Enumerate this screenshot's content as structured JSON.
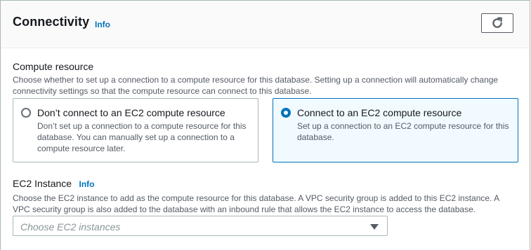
{
  "header": {
    "title": "Connectivity",
    "info_label": "Info"
  },
  "compute": {
    "label": "Compute resource",
    "description": "Choose whether to set up a connection to a compute resource for this database. Setting up a connection will automatically change connectivity settings so that the compute resource can connect to this database.",
    "options": [
      {
        "title": "Don’t connect to an EC2 compute resource",
        "description": "Don’t set up a connection to a compute resource for this database. You can manually set up a connection to a compute resource later.",
        "selected": false
      },
      {
        "title": "Connect to an EC2 compute resource",
        "description": "Set up a connection to an EC2 compute resource for this database.",
        "selected": true
      }
    ]
  },
  "ec2": {
    "label": "EC2 Instance",
    "info_label": "Info",
    "description": "Choose the EC2 instance to add as the compute resource for this database. A VPC security group is added to this EC2 instance. A VPC security group is also added to the database with an inbound rule that allows the EC2 instance to access the database.",
    "select_placeholder": "Choose EC2 instances"
  },
  "colors": {
    "accent": "#0073bb",
    "selected_tile_bg": "#f1faff",
    "border": "#aab7b8",
    "text": "#16191f",
    "secondary_text": "#545b64"
  },
  "icons": {
    "refresh": "refresh-icon",
    "dropdown": "caret-down-icon"
  }
}
